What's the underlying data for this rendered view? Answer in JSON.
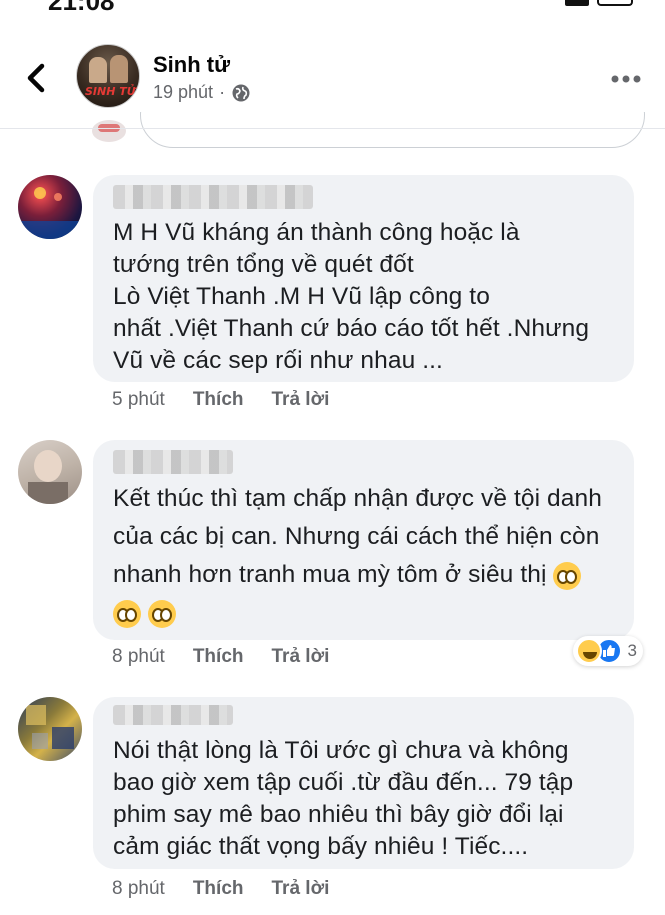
{
  "status_bar": {
    "time": "21:08"
  },
  "header": {
    "page_name": "Sinh tử",
    "time": "19 phút",
    "separator": "·",
    "avatar_logo": "SINH TỬ"
  },
  "comments": [
    {
      "text": "M H Vũ  kháng án thành công  hoặc là\ntướng trên tổng về quét đốt\nLò Việt Thanh .M H Vũ lập công to\nnhất .Việt Thanh cứ báo cáo tốt hết .Nhưng\nVũ về các sep rối như nhau ...",
      "time": "5 phút",
      "like_label": "Thích",
      "reply_label": "Trả lời"
    },
    {
      "text": "Kết thúc thì tạm chấp nhận được về tội danh\ncủa các bị can. Nhưng cái cách thể hiện còn\nnhanh hơn tranh mua mỳ tôm ở siêu thị",
      "time": "8 phút",
      "like_label": "Thích",
      "reply_label": "Trả lời",
      "reaction_count": "3"
    },
    {
      "text": "Nói thật lòng là Tôi ước gì chưa và không\nbao giờ xem tập cuối .từ đầu đến... 79 tập\nphim say mê bao nhiêu thì bây giờ đổi lại\ncảm giác thất vọng bấy nhiêu ! Tiếc....",
      "time": "8 phút",
      "like_label": "Thích",
      "reply_label": "Trả lời"
    }
  ],
  "colors": {
    "bubble": "#f0f2f5",
    "meta": "#65676b",
    "like_blue": "#1877f2"
  }
}
